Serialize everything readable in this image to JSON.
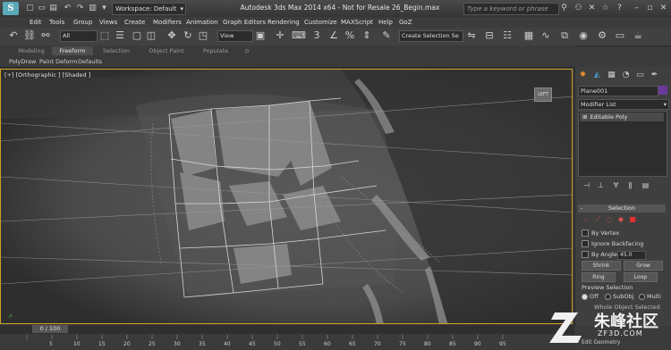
{
  "titlebar": {
    "logo": "S",
    "workspace": "Workspace: Default",
    "title": "Autodesk 3ds Max 2014 x64 - Not for Resale 26_Begin.max",
    "search_placeholder": "Type a keyword or phrase"
  },
  "menu": [
    "Edit",
    "Tools",
    "Group",
    "Views",
    "Create",
    "Modifiers",
    "Animation",
    "Graph Editors",
    "Rendering",
    "Customize",
    "MAXScript",
    "Help",
    "GoZ"
  ],
  "toolbar": {
    "filter": "All",
    "ref_coord": "View",
    "selection_set": "Create Selection Se"
  },
  "ribbon": {
    "tabs": [
      "Modeling",
      "Freeform",
      "Selection",
      "Object Paint",
      "Populate"
    ],
    "active_tab": "Freeform",
    "subtabs": [
      "PolyDraw",
      "Paint Deform",
      "Defaults"
    ]
  },
  "viewport": {
    "label": "[+] [Orthographic ] [Shaded ]",
    "viewcube": "LEFT"
  },
  "command_panel": {
    "object_name": "Plane001",
    "object_color": "#6a3a9a",
    "modifier_list": "Modifier List",
    "stack_item": "Editable Poly",
    "rollout_title": "Selection",
    "by_vertex": "By Vertex",
    "ignore_backfacing": "Ignore Backfacing",
    "by_angle": "By Angle:",
    "angle_value": "45.0",
    "shrink": "Shrink",
    "grow": "Grow",
    "ring": "Ring",
    "loop": "Loop",
    "preview_selection": "Preview Selection",
    "preview_off": "Off",
    "preview_subobj": "SubObj",
    "preview_multi": "Multi",
    "whole_object": "Whole Object Selected",
    "edit_geometry": "Edit Geometry"
  },
  "timeline": {
    "frame": "0 / 100",
    "ticks": [
      "5",
      "10",
      "15",
      "20",
      "25",
      "30",
      "35",
      "40",
      "45",
      "50",
      "55",
      "60",
      "65",
      "70",
      "75",
      "80",
      "85",
      "90",
      "95"
    ]
  },
  "watermark": {
    "main": "朱峰社区",
    "sub": "ZF3D.COM"
  }
}
